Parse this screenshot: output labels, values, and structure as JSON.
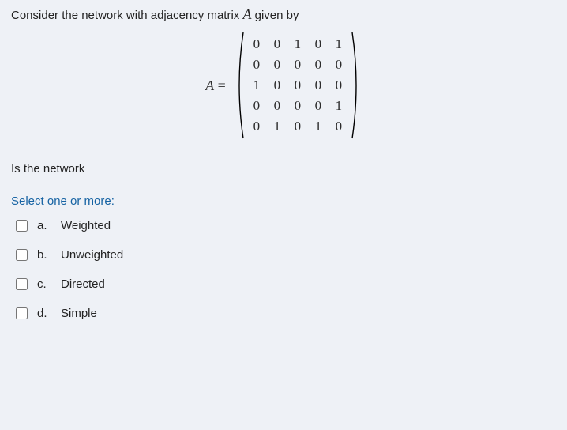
{
  "prompt_prefix": "Consider the network with adjacency matrix ",
  "matrix_var": "A",
  "prompt_suffix": " given by",
  "matrix_label_pre": "A",
  "matrix_label_eq": " = ",
  "matrix": {
    "rows": [
      [
        "0",
        "0",
        "1",
        "0",
        "1"
      ],
      [
        "0",
        "0",
        "0",
        "0",
        "0"
      ],
      [
        "1",
        "0",
        "0",
        "0",
        "0"
      ],
      [
        "0",
        "0",
        "0",
        "0",
        "1"
      ],
      [
        "0",
        "1",
        "0",
        "1",
        "0"
      ]
    ]
  },
  "question2": "Is the network",
  "select_label": "Select one or more:",
  "options": [
    {
      "letter": "a.",
      "text": "Weighted"
    },
    {
      "letter": "b.",
      "text": "Unweighted"
    },
    {
      "letter": "c.",
      "text": "Directed"
    },
    {
      "letter": "d.",
      "text": "Simple"
    }
  ]
}
